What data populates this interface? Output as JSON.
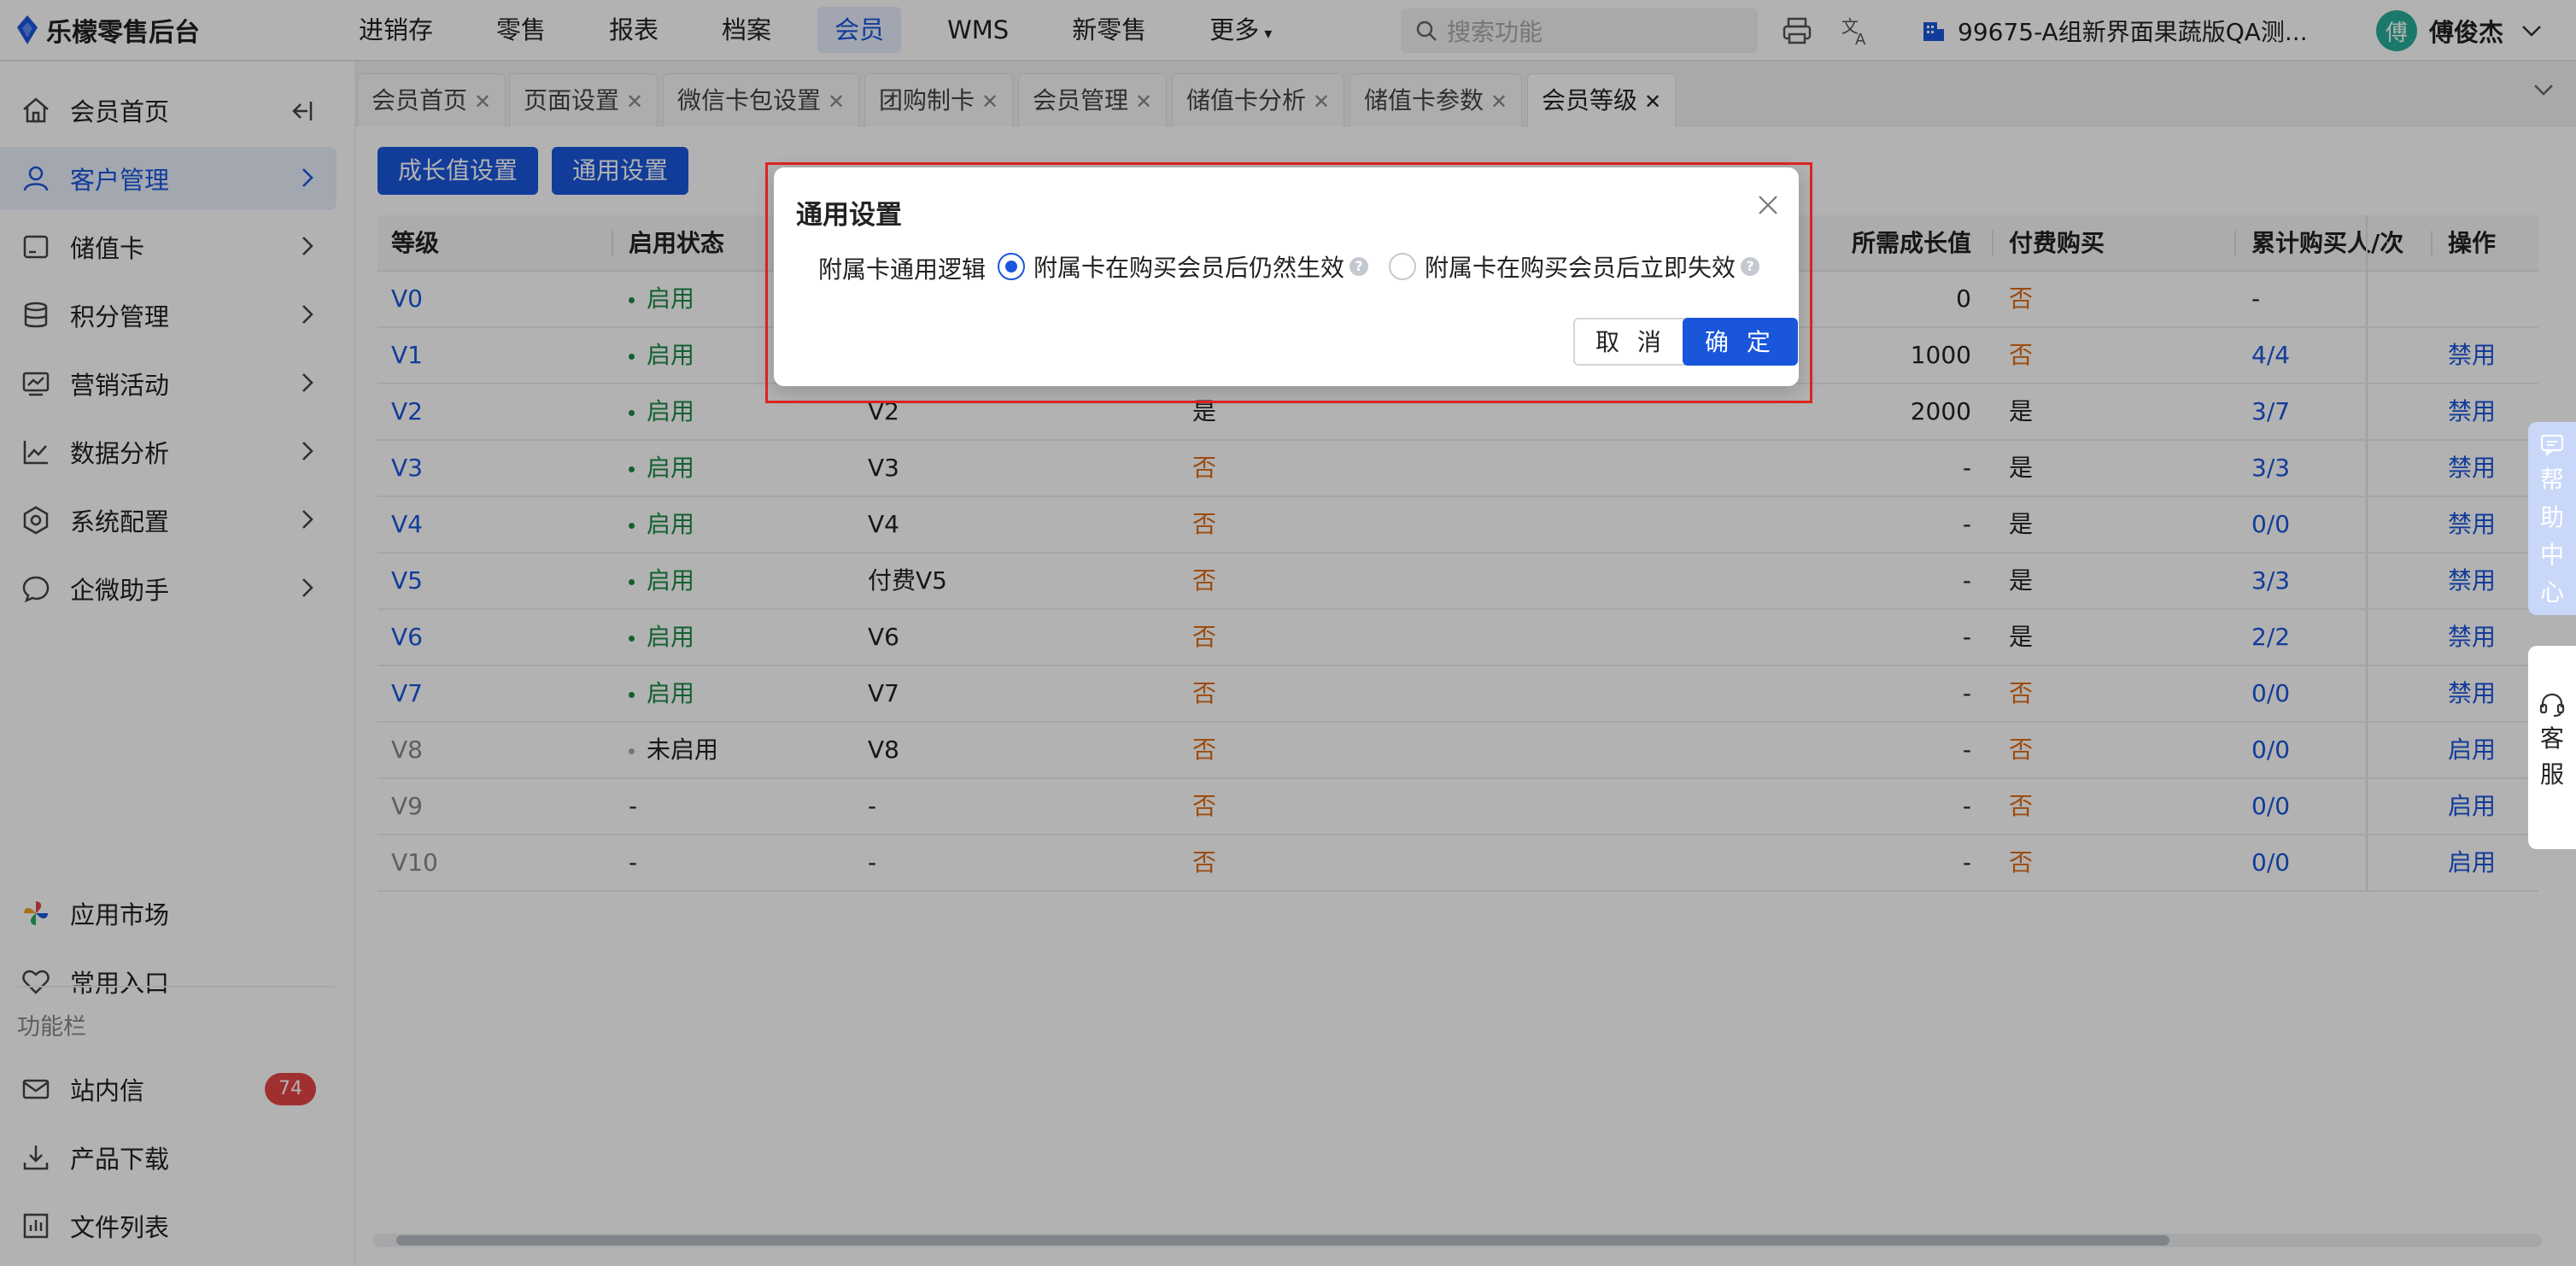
{
  "app": {
    "title": "乐檬零售后台"
  },
  "topnav": {
    "items": [
      "进销存",
      "零售",
      "报表",
      "档案",
      "会员",
      "WMS",
      "新零售",
      "更多"
    ],
    "active": "会员",
    "search_placeholder": "搜索功能",
    "store": "99675-A组新界面果蔬版QA测...",
    "user": {
      "name": "傅俊杰",
      "avatar_char": "傅"
    }
  },
  "sidebar": {
    "items": [
      {
        "label": "会员首页",
        "icon": "home-icon"
      },
      {
        "label": "客户管理",
        "icon": "user-icon"
      },
      {
        "label": "储值卡",
        "icon": "card-icon"
      },
      {
        "label": "积分管理",
        "icon": "database-icon"
      },
      {
        "label": "营销活动",
        "icon": "monitor-icon"
      },
      {
        "label": "数据分析",
        "icon": "chart-line-icon"
      },
      {
        "label": "系统配置",
        "icon": "settings-icon"
      },
      {
        "label": "企微助手",
        "icon": "chat-icon"
      }
    ],
    "bottom_items": [
      {
        "label": "应用市场",
        "icon": "pinwheel-icon"
      },
      {
        "label": "常用入口",
        "icon": "heart-icon"
      }
    ],
    "group_label": "功能栏",
    "func_items": [
      {
        "label": "站内信",
        "badge": "74"
      },
      {
        "label": "产品下载"
      },
      {
        "label": "文件列表"
      }
    ]
  },
  "tabs": [
    "会员首页",
    "页面设置",
    "微信卡包设置",
    "团购制卡",
    "会员管理",
    "储值卡分析",
    "储值卡参数",
    "会员等级"
  ],
  "active_tab": "会员等级",
  "toolbar": {
    "growth_btn": "成长值设置",
    "general_btn": "通用设置"
  },
  "table": {
    "headers": {
      "level": "等级",
      "status": "启用状态",
      "growth": "所需成长值",
      "paid": "付费购买",
      "buyers": "累计购买人/次",
      "ops": "操作"
    },
    "rows": [
      {
        "level": "V0",
        "status": "启用",
        "name": "",
        "flag": "",
        "growth": "0",
        "paid": "否",
        "buyers": "-",
        "op": ""
      },
      {
        "level": "V1",
        "status": "启用",
        "name": "",
        "flag": "",
        "growth": "1000",
        "paid": "否",
        "buyers": "4/4",
        "op": "禁用"
      },
      {
        "level": "V2",
        "status": "启用",
        "name": "V2",
        "flag": "是",
        "growth": "2000",
        "paid": "是",
        "buyers": "3/7",
        "op": "禁用"
      },
      {
        "level": "V3",
        "status": "启用",
        "name": "V3",
        "flag": "否",
        "growth": "-",
        "paid": "是",
        "buyers": "3/3",
        "op": "禁用"
      },
      {
        "level": "V4",
        "status": "启用",
        "name": "V4",
        "flag": "否",
        "growth": "-",
        "paid": "是",
        "buyers": "0/0",
        "op": "禁用"
      },
      {
        "level": "V5",
        "status": "启用",
        "name": "付费V5",
        "flag": "否",
        "growth": "-",
        "paid": "是",
        "buyers": "3/3",
        "op": "禁用"
      },
      {
        "level": "V6",
        "status": "启用",
        "name": "V6",
        "flag": "否",
        "growth": "-",
        "paid": "是",
        "buyers": "2/2",
        "op": "禁用"
      },
      {
        "level": "V7",
        "status": "启用",
        "name": "V7",
        "flag": "否",
        "growth": "-",
        "paid": "否",
        "buyers": "0/0",
        "op": "禁用"
      },
      {
        "level": "V8",
        "status": "未启用",
        "name": "V8",
        "flag": "否",
        "growth": "-",
        "paid": "否",
        "buyers": "0/0",
        "op": "启用"
      },
      {
        "level": "V9",
        "status": "-",
        "name": "-",
        "flag": "否",
        "growth": "-",
        "paid": "否",
        "buyers": "0/0",
        "op": "启用"
      },
      {
        "level": "V10",
        "status": "-",
        "name": "-",
        "flag": "否",
        "growth": "-",
        "paid": "否",
        "buyers": "0/0",
        "op": "启用"
      }
    ]
  },
  "float": {
    "help": [
      "帮",
      "助",
      "中",
      "心"
    ],
    "cs": [
      "客",
      "服"
    ]
  },
  "modal": {
    "title": "通用设置",
    "label": "附属卡通用逻辑",
    "option1": "附属卡在购买会员后仍然生效",
    "option2": "附属卡在购买会员后立即失效",
    "selected": "option1",
    "cancel": "取 消",
    "ok": "确 定"
  },
  "colors": {
    "primary": "#1a56db",
    "success": "#1e8a47",
    "warning": "#e06d16",
    "danger": "#e02424"
  }
}
